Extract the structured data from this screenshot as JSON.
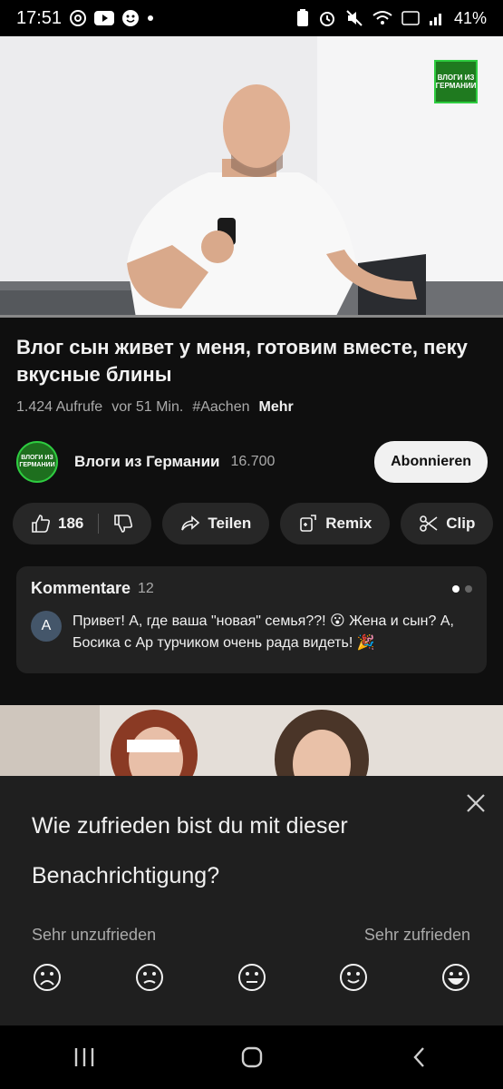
{
  "status_bar": {
    "time": "17:51",
    "battery": "41%",
    "left_icons": [
      "at-sign-icon",
      "youtube-icon",
      "face-icon",
      "dot-icon"
    ],
    "right_icons": [
      "battery-saver-icon",
      "alarm-icon",
      "mute-icon",
      "wifi-icon",
      "volte-icon",
      "signal-icon"
    ]
  },
  "video": {
    "watermark_text": "ВЛОГИ ИЗ ГЕРМАНИИ"
  },
  "title": "Влог сын живет у меня, готовим вместе, пеку вкусные блины",
  "meta": {
    "views": "1.424 Aufrufe",
    "age": "vor 51 Min.",
    "hashtag": "#Aachen",
    "more": "Mehr"
  },
  "channel": {
    "name": "Влоги из Германии",
    "subscribers": "16.700",
    "subscribe_label": "Abonnieren",
    "avatar_text": "ВЛОГИ ИЗ ГЕРМАНИИ"
  },
  "actions": {
    "likes": "186",
    "share": "Teilen",
    "remix": "Remix",
    "clip": "Clip"
  },
  "comments": {
    "title": "Kommentare",
    "count": "12",
    "top_comment": {
      "author_initial": "A",
      "text": "Привет! А, где ваша \"новая\" семья??! 😮 Жена и сын? А, Босика  с Ар турчиком очень рада видеть! 🎉"
    }
  },
  "survey": {
    "question": "Wie zufrieden bist du mit dieser Benachrichtigung?",
    "low_label": "Sehr unzufrieden",
    "high_label": "Sehr zufrieden",
    "options": [
      "very-dissatisfied-icon",
      "dissatisfied-icon",
      "neutral-icon",
      "satisfied-icon",
      "very-satisfied-icon"
    ]
  },
  "nav_bar": [
    "recents-icon",
    "home-icon",
    "back-icon"
  ],
  "colors": {
    "background": "#0f0f0f",
    "surface": "#272727",
    "subscribe_bg": "#f1f1f1",
    "channel_green": "#2ecc40"
  }
}
